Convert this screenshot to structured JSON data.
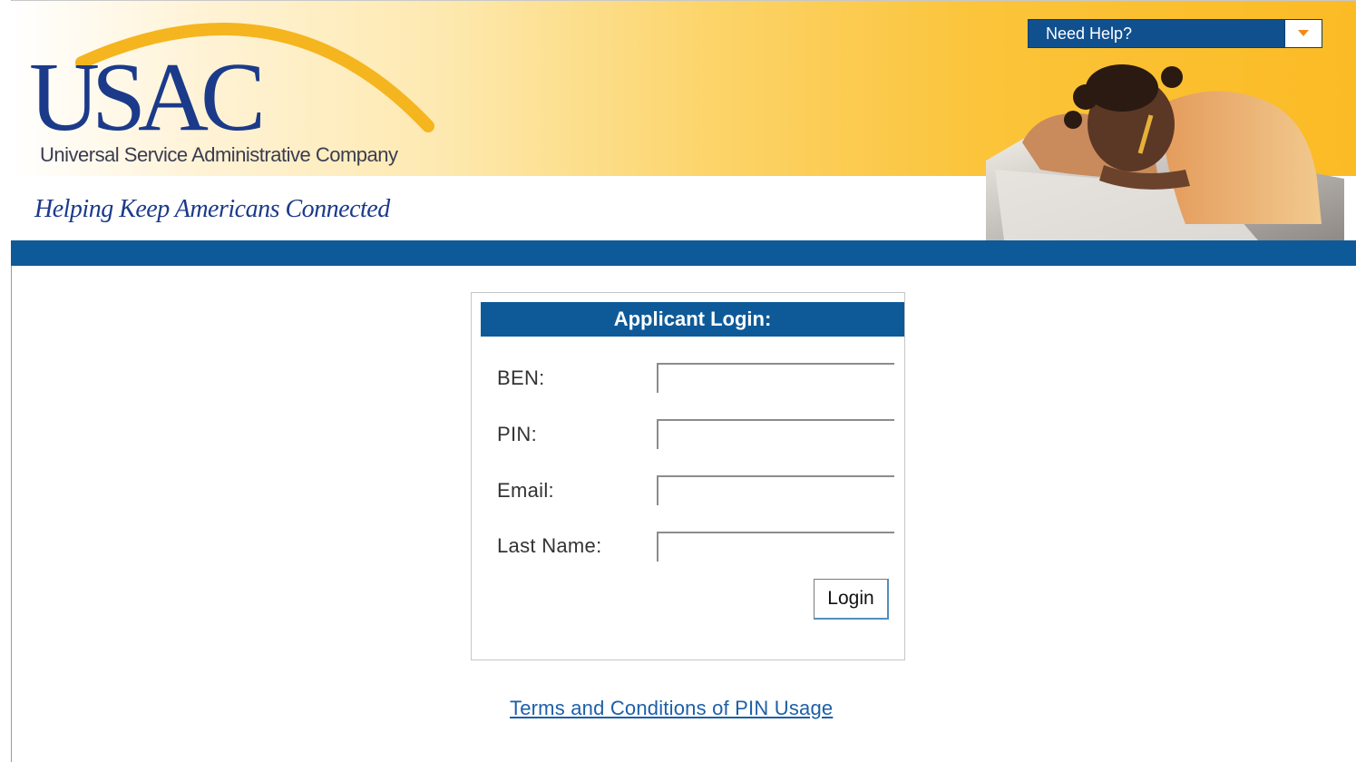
{
  "header": {
    "logo": "USAC",
    "company_name": "Universal Service Administrative Company",
    "tagline": "Helping Keep Americans Connected",
    "help_menu": {
      "selected": "Need Help?",
      "arrow_icon": "caret-down-icon"
    },
    "photo": "student-resting-on-desk-writing-photo"
  },
  "login": {
    "title": "Applicant Login:",
    "fields": [
      {
        "label": "BEN:",
        "value": ""
      },
      {
        "label": "PIN:",
        "value": ""
      },
      {
        "label": "Email:",
        "value": ""
      },
      {
        "label": "Last Name:",
        "value": ""
      }
    ],
    "submit_label": "Login"
  },
  "footer": {
    "terms_link": "Terms and Conditions of PIN Usage"
  },
  "colors": {
    "brand_blue": "#0e5a99",
    "logo_blue": "#1b3a8a",
    "header_gold": "#fbbb25",
    "link_blue": "#1d5fa8",
    "arrow_orange": "#f08a1c"
  }
}
